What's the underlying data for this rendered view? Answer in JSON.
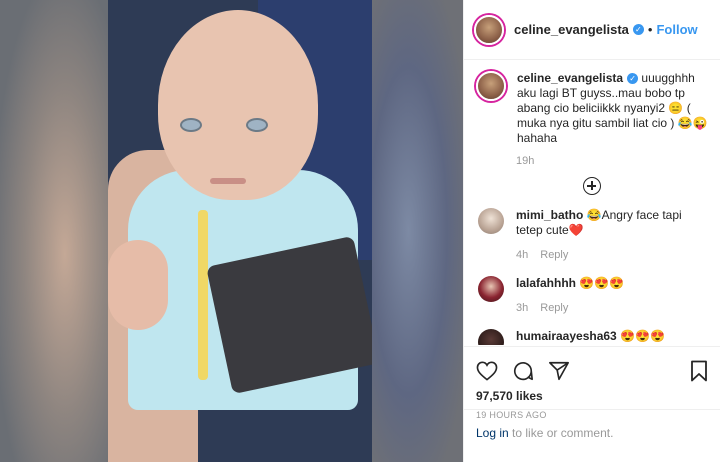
{
  "post": {
    "username": "celine_evangelista",
    "follow_label": "Follow",
    "separator": "•",
    "caption_text": "uuugghhh aku lagi BT guyss..mau bobo tp abang cio beliciikkk nyanyi2 😑 ( muka nya gitu sambil liat cio ) 😂😜 hahaha",
    "caption_time": "19h"
  },
  "comments": [
    {
      "username": "mimi_batho",
      "text": "😂Angry face tapi tetep cute❤️",
      "time": "4h",
      "reply": "Reply"
    },
    {
      "username": "lalafahhhh",
      "text": "😍😍😍",
      "time": "3h",
      "reply": "Reply"
    },
    {
      "username": "humairaayesha63",
      "text": "😍😍😍"
    }
  ],
  "footer": {
    "likes": "97,570 likes",
    "posted_ago": "19 HOURS AGO",
    "login_link": "Log in",
    "login_suffix": " to like or comment."
  },
  "colors": {
    "accent": "#3897f0",
    "text": "#262626",
    "muted": "#999999",
    "link": "#003569"
  },
  "icons": [
    "verified-icon",
    "load-more-icon",
    "heart-icon",
    "comment-icon",
    "share-icon",
    "bookmark-icon"
  ]
}
